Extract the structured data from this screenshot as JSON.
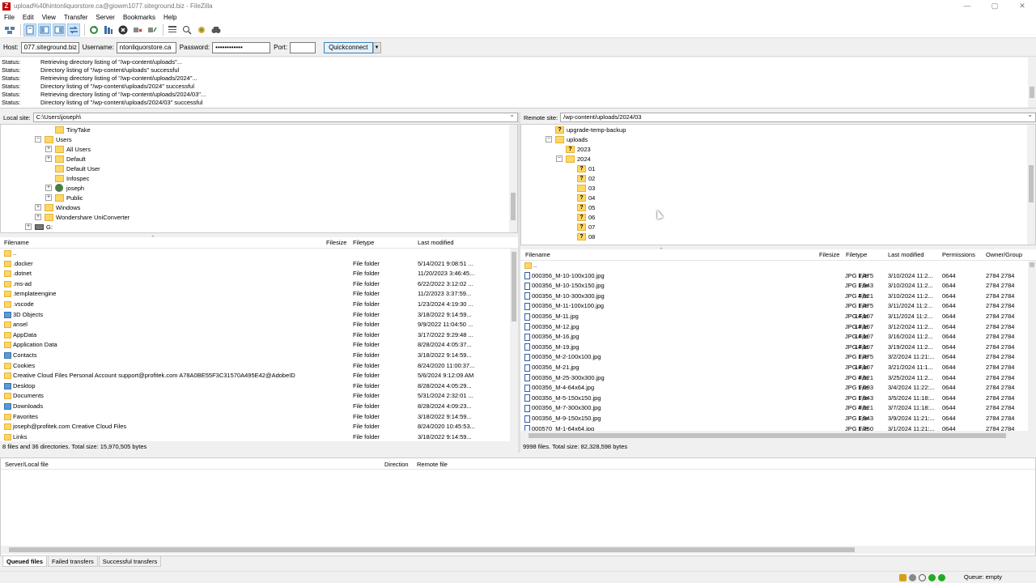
{
  "window": {
    "title": "upload%40hintonliquorstore.ca@giowm1077.siteground.biz - FileZilla",
    "controls": {
      "minimize": "—",
      "maximize": "▢",
      "close": "✕"
    }
  },
  "menu": [
    "File",
    "Edit",
    "View",
    "Transfer",
    "Server",
    "Bookmarks",
    "Help"
  ],
  "quickconnect": {
    "host_label": "Host:",
    "host_value": "077.siteground.biz",
    "username_label": "Username:",
    "username_value": "ntonliquorstore.ca",
    "password_label": "Password:",
    "password_value": "••••••••••••",
    "port_label": "Port:",
    "port_value": "",
    "button": "Quickconnect",
    "dropdown": "▼"
  },
  "log": [
    {
      "k": "Status:",
      "v": "Retrieving directory listing of \"/wp-content/uploads\"..."
    },
    {
      "k": "Status:",
      "v": "Directory listing of \"/wp-content/uploads\" successful"
    },
    {
      "k": "Status:",
      "v": "Retrieving directory listing of \"/wp-content/uploads/2024\"..."
    },
    {
      "k": "Status:",
      "v": "Directory listing of \"/wp-content/uploads/2024\" successful"
    },
    {
      "k": "Status:",
      "v": "Retrieving directory listing of \"/wp-content/uploads/2024/03\"..."
    },
    {
      "k": "Status:",
      "v": "Directory listing of \"/wp-content/uploads/2024/03\" successful"
    }
  ],
  "local": {
    "site_label": "Local site:",
    "site_path": "C:\\Users\\joseph\\",
    "tree": [
      {
        "name": "TinyTake",
        "exp": ""
      },
      {
        "name": "Users",
        "exp": "−"
      },
      {
        "name": "All Users",
        "exp": "+"
      },
      {
        "name": "Default",
        "exp": "+"
      },
      {
        "name": "Default User",
        "exp": ""
      },
      {
        "name": "Infospec",
        "exp": ""
      },
      {
        "name": "joseph",
        "exp": "+"
      },
      {
        "name": "Public",
        "exp": "+"
      },
      {
        "name": "Windows",
        "exp": "+"
      },
      {
        "name": "Wondershare UniConverter",
        "exp": "+"
      },
      {
        "name": "G:",
        "exp": "+"
      }
    ],
    "headers": {
      "filename": "Filename",
      "filesize": "Filesize",
      "filetype": "Filetype",
      "modified": "Last modified"
    },
    "files": [
      {
        "name": "..",
        "type": "",
        "date": "",
        "icon": "folder"
      },
      {
        "name": ".docker",
        "type": "File folder",
        "date": "5/14/2021 9:08:51 ...",
        "icon": "folder"
      },
      {
        "name": ".dotnet",
        "type": "File folder",
        "date": "11/20/2023 3:46:45...",
        "icon": "folder"
      },
      {
        "name": ".ms-ad",
        "type": "File folder",
        "date": "6/22/2022 3:12:02 ...",
        "icon": "folder"
      },
      {
        "name": ".templateengine",
        "type": "File folder",
        "date": "11/2/2023 3:37:59...",
        "icon": "folder"
      },
      {
        "name": ".vscode",
        "type": "File folder",
        "date": "1/23/2024 4:19:30 ...",
        "icon": "folder"
      },
      {
        "name": "3D Objects",
        "type": "File folder",
        "date": "3/18/2022 9:14:59...",
        "icon": "blue"
      },
      {
        "name": "ansel",
        "type": "File folder",
        "date": "9/9/2022 11:04:50 ...",
        "icon": "folder"
      },
      {
        "name": "AppData",
        "type": "File folder",
        "date": "3/17/2022 9:29:48 ...",
        "icon": "folder"
      },
      {
        "name": "Application Data",
        "type": "File folder",
        "date": "8/28/2024 4:05:37...",
        "icon": "folder"
      },
      {
        "name": "Contacts",
        "type": "File folder",
        "date": "3/18/2022 9:14:59...",
        "icon": "blue"
      },
      {
        "name": "Cookies",
        "type": "File folder",
        "date": "8/24/2020 11:00:37...",
        "icon": "folder"
      },
      {
        "name": "Creative Cloud Files Personal Account support@profitek.com A78A0BE55F3C31570A495E42@AdobeID",
        "type": "File folder",
        "date": "5/6/2024 9:12:09 AM",
        "icon": "folder"
      },
      {
        "name": "Desktop",
        "type": "File folder",
        "date": "8/28/2024 4:05:29...",
        "icon": "blue"
      },
      {
        "name": "Documents",
        "type": "File folder",
        "date": "5/31/2024 2:32:01 ...",
        "icon": "folder"
      },
      {
        "name": "Downloads",
        "type": "File folder",
        "date": "8/28/2024 4:09:23...",
        "icon": "blue"
      },
      {
        "name": "Favorites",
        "type": "File folder",
        "date": "3/18/2022 9:14:59...",
        "icon": "folder"
      },
      {
        "name": "joseph@profitek.com Creative Cloud Files",
        "type": "File folder",
        "date": "8/24/2020 10:45:53...",
        "icon": "folder"
      },
      {
        "name": "Links",
        "type": "File folder",
        "date": "3/18/2022 9:14:59...",
        "icon": "folder"
      }
    ],
    "status": "8 files and 36 directories. Total size: 15,970,505 bytes"
  },
  "remote": {
    "site_label": "Remote site:",
    "site_path": "/wp-content/uploads/2024/03",
    "tree": [
      {
        "name": "upgrade-temp-backup",
        "q": true,
        "exp": ""
      },
      {
        "name": "uploads",
        "q": false,
        "exp": "−"
      },
      {
        "name": "2023",
        "q": true,
        "exp": ""
      },
      {
        "name": "2024",
        "q": false,
        "exp": "−"
      },
      {
        "name": "01",
        "q": true,
        "exp": ""
      },
      {
        "name": "02",
        "q": true,
        "exp": ""
      },
      {
        "name": "03",
        "q": false,
        "exp": ""
      },
      {
        "name": "04",
        "q": true,
        "exp": ""
      },
      {
        "name": "05",
        "q": true,
        "exp": ""
      },
      {
        "name": "06",
        "q": true,
        "exp": ""
      },
      {
        "name": "07",
        "q": true,
        "exp": ""
      },
      {
        "name": "08",
        "q": true,
        "exp": ""
      }
    ],
    "headers": {
      "filename": "Filename",
      "filesize": "Filesize",
      "filetype": "Filetype",
      "modified": "Last modified",
      "perms": "Permissions",
      "owner": "Owner/Group"
    },
    "files": [
      {
        "name": "..",
        "size": "",
        "type": "",
        "date": "",
        "perm": "",
        "owner": "",
        "icon": "folder"
      },
      {
        "name": "000356_M-10-100x100.jpg",
        "size": "1,475",
        "type": "JPG File",
        "date": "3/10/2024 11:2...",
        "perm": "0644",
        "owner": "2784 2784",
        "icon": "jpg"
      },
      {
        "name": "000356_M-10-150x150.jpg",
        "size": "1,943",
        "type": "JPG File",
        "date": "3/10/2024 11:2...",
        "perm": "0644",
        "owner": "2784 2784",
        "icon": "jpg"
      },
      {
        "name": "000356_M-10-300x300.jpg",
        "size": "4,521",
        "type": "JPG File",
        "date": "3/10/2024 11:2...",
        "perm": "0644",
        "owner": "2784 2784",
        "icon": "jpg"
      },
      {
        "name": "000356_M-11-100x100.jpg",
        "size": "1,475",
        "type": "JPG File",
        "date": "3/11/2024 11:2...",
        "perm": "0644",
        "owner": "2784 2784",
        "icon": "jpg"
      },
      {
        "name": "000356_M-11.jpg",
        "size": "14,107",
        "type": "JPG File",
        "date": "3/11/2024 11:2...",
        "perm": "0644",
        "owner": "2784 2784",
        "icon": "jpg"
      },
      {
        "name": "000356_M-12.jpg",
        "size": "14,107",
        "type": "JPG File",
        "date": "3/12/2024 11:2...",
        "perm": "0644",
        "owner": "2784 2784",
        "icon": "jpg"
      },
      {
        "name": "000356_M-16.jpg",
        "size": "14,107",
        "type": "JPG File",
        "date": "3/16/2024 11:2...",
        "perm": "0644",
        "owner": "2784 2784",
        "icon": "jpg"
      },
      {
        "name": "000356_M-19.jpg",
        "size": "14,107",
        "type": "JPG File",
        "date": "3/19/2024 11:2...",
        "perm": "0644",
        "owner": "2784 2784",
        "icon": "jpg"
      },
      {
        "name": "000356_M-2-100x100.jpg",
        "size": "1,475",
        "type": "JPG File",
        "date": "3/2/2024 11:21:...",
        "perm": "0644",
        "owner": "2784 2784",
        "icon": "jpg"
      },
      {
        "name": "000356_M-21.jpg",
        "size": "14,107",
        "type": "JPG File",
        "date": "3/21/2024 11:1...",
        "perm": "0644",
        "owner": "2784 2784",
        "icon": "jpg"
      },
      {
        "name": "000356_M-25-300x300.jpg",
        "size": "4,521",
        "type": "JPG File",
        "date": "3/25/2024 11:2...",
        "perm": "0644",
        "owner": "2784 2784",
        "icon": "jpg"
      },
      {
        "name": "000356_M-4-64x64.jpg",
        "size": "1,093",
        "type": "JPG File",
        "date": "3/4/2024 11:22:...",
        "perm": "0644",
        "owner": "2784 2784",
        "icon": "jpg"
      },
      {
        "name": "000356_M-5-150x150.jpg",
        "size": "1,943",
        "type": "JPG File",
        "date": "3/5/2024 11:18:...",
        "perm": "0644",
        "owner": "2784 2784",
        "icon": "jpg"
      },
      {
        "name": "000356_M-7-300x300.jpg",
        "size": "4,521",
        "type": "JPG File",
        "date": "3/7/2024 11:18:...",
        "perm": "0644",
        "owner": "2784 2784",
        "icon": "jpg"
      },
      {
        "name": "000356_M-9-150x150.jpg",
        "size": "1,943",
        "type": "JPG File",
        "date": "3/9/2024 11:21:...",
        "perm": "0644",
        "owner": "2784 2784",
        "icon": "jpg"
      },
      {
        "name": "000570_M-1-64x64.jpg",
        "size": "1,750",
        "type": "JPG File",
        "date": "3/1/2024 11:21:...",
        "perm": "0644",
        "owner": "2784 2784",
        "icon": "jpg"
      }
    ],
    "status": "9998 files. Total size: 82,328,598 bytes"
  },
  "queue": {
    "headers": {
      "server": "Server/Local file",
      "direction": "Direction",
      "remote": "Remote file"
    },
    "tabs": [
      "Queued files",
      "Failed transfers",
      "Successful transfers"
    ],
    "status": "Queue: empty"
  },
  "colors": {
    "accent": "#3c7fb1",
    "folder": "#ffd766",
    "background": "#f0f0f0"
  }
}
